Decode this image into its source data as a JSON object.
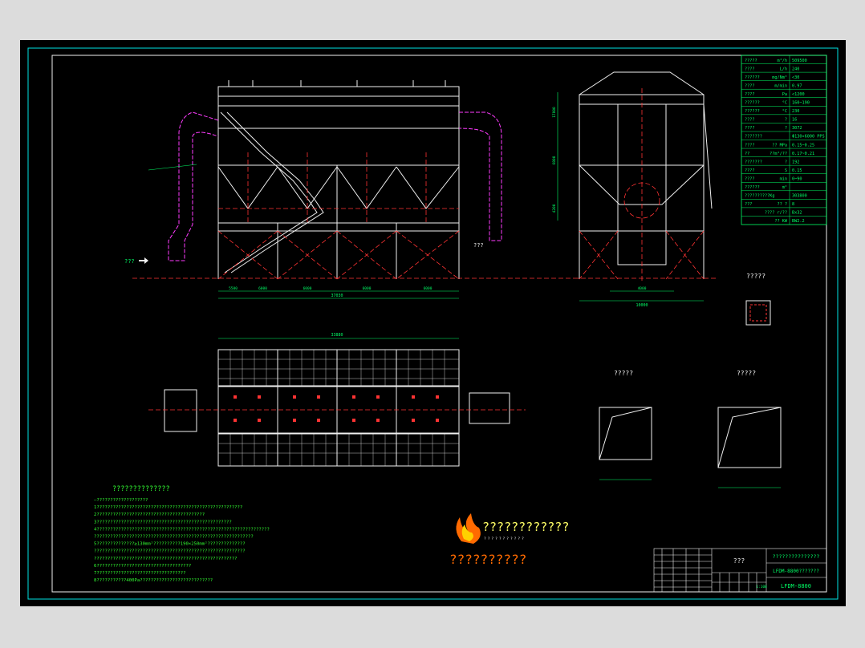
{
  "colors": {
    "background": "#000000",
    "frame": "#00e5e5",
    "structure": "#f0f0f0",
    "centerline": "#ff3333",
    "duct": "#ff3cff",
    "notes": "#33ff33",
    "dims": "#00ff66",
    "title_text": "#ffff66",
    "logo": "#ff6a00"
  },
  "icons": [
    "flame-logo-icon",
    "inlet-arrow-icon"
  ],
  "spec_table": [
    {
      "name": "?????",
      "unit": "m³/h",
      "value": "509500"
    },
    {
      "name": "????",
      "unit": "L/h",
      "value": "240"
    },
    {
      "name": "??????",
      "unit": "mg/Nm³",
      "value": "<30"
    },
    {
      "name": "????",
      "unit": "m/min",
      "value": "0.97"
    },
    {
      "name": "????",
      "unit": "Pa",
      "value": "<1200"
    },
    {
      "name": "??????",
      "unit": "°C",
      "value": "160~190"
    },
    {
      "name": "??????",
      "unit": "°C",
      "value": "230"
    },
    {
      "name": "????",
      "unit": "?",
      "value": "16"
    },
    {
      "name": "????",
      "unit": "?",
      "value": "3072"
    },
    {
      "name": "???????",
      "unit": "",
      "value": "Φ130×6000 PPS"
    },
    {
      "name": "????",
      "unit": "??  MPa",
      "value": "0.15~0.25"
    },
    {
      "name": "??",
      "unit": "??m³/??",
      "value": "0.17~0.21"
    },
    {
      "name": "???????",
      "unit": "?",
      "value": "192"
    },
    {
      "name": "????",
      "unit": "S",
      "value": "0.15"
    },
    {
      "name": "????",
      "unit": "min",
      "value": "0~90"
    },
    {
      "name": "??????",
      "unit": "m²",
      "value": ""
    },
    {
      "name": "??????????Kg",
      "unit": "",
      "value": "303800"
    },
    {
      "name": "???",
      "unit": "??  ?",
      "value": "8"
    },
    {
      "name": "",
      "unit": "????  r/??",
      "value": "Bx32"
    },
    {
      "name": "",
      "unit": "??  KW",
      "value": "BW2.2"
    }
  ],
  "labels": {
    "inlet": "???",
    "outlet": "???",
    "section_1": "?????",
    "section_2": "?????",
    "section_3": "?????"
  },
  "notes": {
    "title": "??????????????",
    "lines": [
      "—???????????????????",
      "1??????????????????????????????????????????????????????",
      "2????????????????????????????????????????",
      "3??????????????????????????????????????????????????",
      "4????????????????????????????????????????????????????????????????",
      "  ???????????????????????????????????????????????????????????",
      "5??????????????≥130mm²??????????190×250mm²??????????????",
      "  ????????????????????????????????????????????????????????",
      "  ?????????????????????????????????????????????????????",
      "6???????????????????????????????????",
      "7?????????????????????????????????",
      "8???????????400Pa???????????????????????????"
    ]
  },
  "logo": {
    "line_1": "????????????",
    "line_2": "???????????",
    "caption": "??????????"
  },
  "title_block": {
    "main_cell": "???",
    "company": "???????????????",
    "drawing_name": "LFDM-8800???????",
    "model": "LFDM-8800",
    "scale": "1:100"
  },
  "dims": {
    "side_total": "37030",
    "side_bays": [
      "5500",
      "6000",
      "6000",
      "6000",
      "6000"
    ],
    "plan_total": "33880",
    "end_width": "10000",
    "end_inner": "4000",
    "heights": [
      "17800",
      "6800",
      "4200"
    ]
  }
}
